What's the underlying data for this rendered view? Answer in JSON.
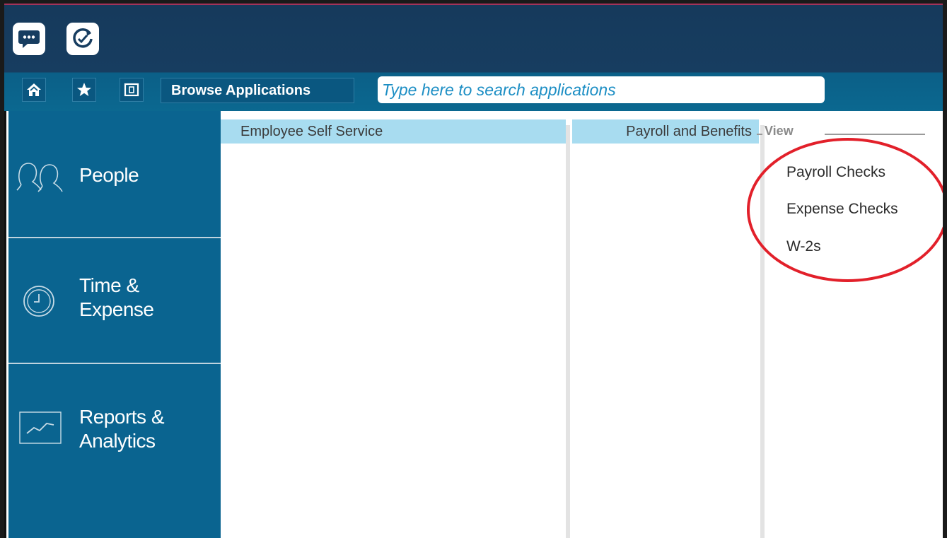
{
  "toolbar": {
    "chat_icon": "chat-bubble-icon",
    "refresh_icon": "refresh-check-icon",
    "home_icon": "home-icon",
    "favorites_icon": "star-icon",
    "panel_icon": "panel-icon",
    "browse_label": "Browse Applications",
    "search_placeholder": "Type here to search applications"
  },
  "sidebar": {
    "items": [
      {
        "label": "People",
        "icon": "people-icon"
      },
      {
        "label_line1": "Time &",
        "label_line2": "Expense",
        "icon": "clock-icon"
      },
      {
        "label_line1": "Reports &",
        "label_line2": "Analytics",
        "icon": "chart-icon"
      }
    ]
  },
  "columns": {
    "col1": "Employee Self Service",
    "col2": "Payroll and Benefits"
  },
  "view": {
    "title": "View",
    "links": [
      "Payroll Checks",
      "Expense Checks",
      "W-2s"
    ]
  },
  "colors": {
    "topbar_dark": "#163a5c",
    "topbar_light": "#0b6890",
    "sidebar": "#0a6490",
    "column_header": "#a8dcf0",
    "highlight_circle": "#e2202a"
  }
}
